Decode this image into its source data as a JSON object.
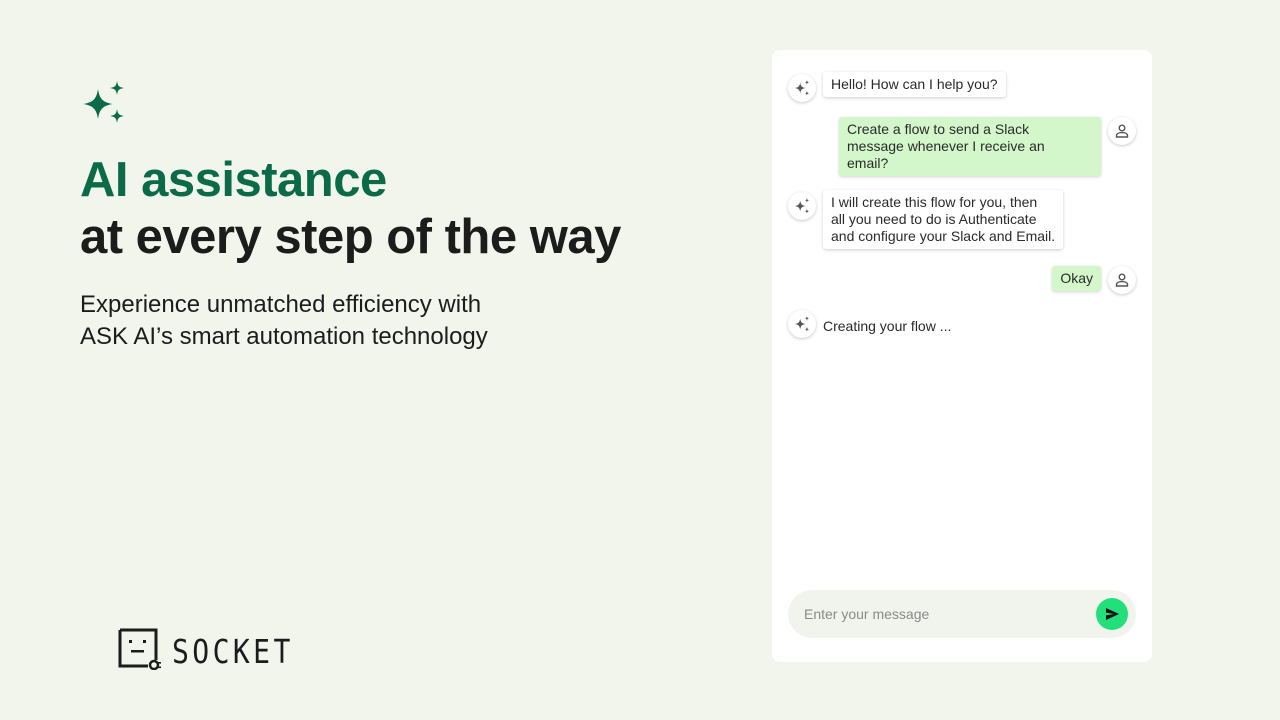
{
  "hero": {
    "icon": "sparkles-icon",
    "headline_accent": "AI assistance",
    "headline_rest": "at every step of the way",
    "subtitle_line1": "Experience unmatched efficiency with",
    "subtitle_line2": "ASK AI’s smart automation technology",
    "accent_color": "#0b6b48"
  },
  "logo": {
    "text": "SOCKET",
    "icon": "socket-logo-icon"
  },
  "chat": {
    "messages": [
      {
        "role": "bot",
        "icon": "sparkles-icon",
        "lines": [
          "Hello! How can I help you?"
        ]
      },
      {
        "role": "user",
        "icon": "user-icon",
        "lines": [
          "Create a flow to send a Slack",
          "message whenever I receive an",
          "email?"
        ]
      },
      {
        "role": "bot",
        "icon": "sparkles-icon",
        "lines": [
          "I will create this flow for you,  then",
          "all you need to do is Authenticate",
          "and configure your Slack and Email."
        ]
      },
      {
        "role": "user",
        "icon": "user-icon",
        "lines": [
          "Okay"
        ]
      },
      {
        "role": "bot",
        "icon": "sparkles-icon",
        "lines": [
          "Creating your flow ..."
        ]
      }
    ],
    "input_placeholder": "Enter your message",
    "send_icon": "send-icon",
    "user_bubble_color": "#d3f7ca",
    "send_button_color": "#21e07b"
  }
}
